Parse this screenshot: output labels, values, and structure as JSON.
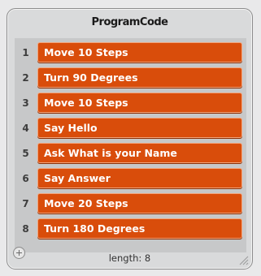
{
  "panel": {
    "title": "ProgramCode",
    "items": [
      {
        "index": "1",
        "label": "Move 10 Steps"
      },
      {
        "index": "2",
        "label": "Turn 90 Degrees"
      },
      {
        "index": "3",
        "label": "Move 10 Steps"
      },
      {
        "index": "4",
        "label": "Say Hello"
      },
      {
        "index": "5",
        "label": "Ask What is your Name"
      },
      {
        "index": "6",
        "label": "Say Answer"
      },
      {
        "index": "7",
        "label": "Move 20 Steps"
      },
      {
        "index": "8",
        "label": "Turn 180 Degrees"
      }
    ],
    "footer": {
      "length_text": "length: 8",
      "add_icon": "plus-icon",
      "resize_icon": "resize-grip-icon"
    }
  },
  "colors": {
    "item_fill": "#d94d0b",
    "item_text": "#ffffff",
    "list_background": "#c7c8c9",
    "panel_background": "#d9dadb"
  }
}
